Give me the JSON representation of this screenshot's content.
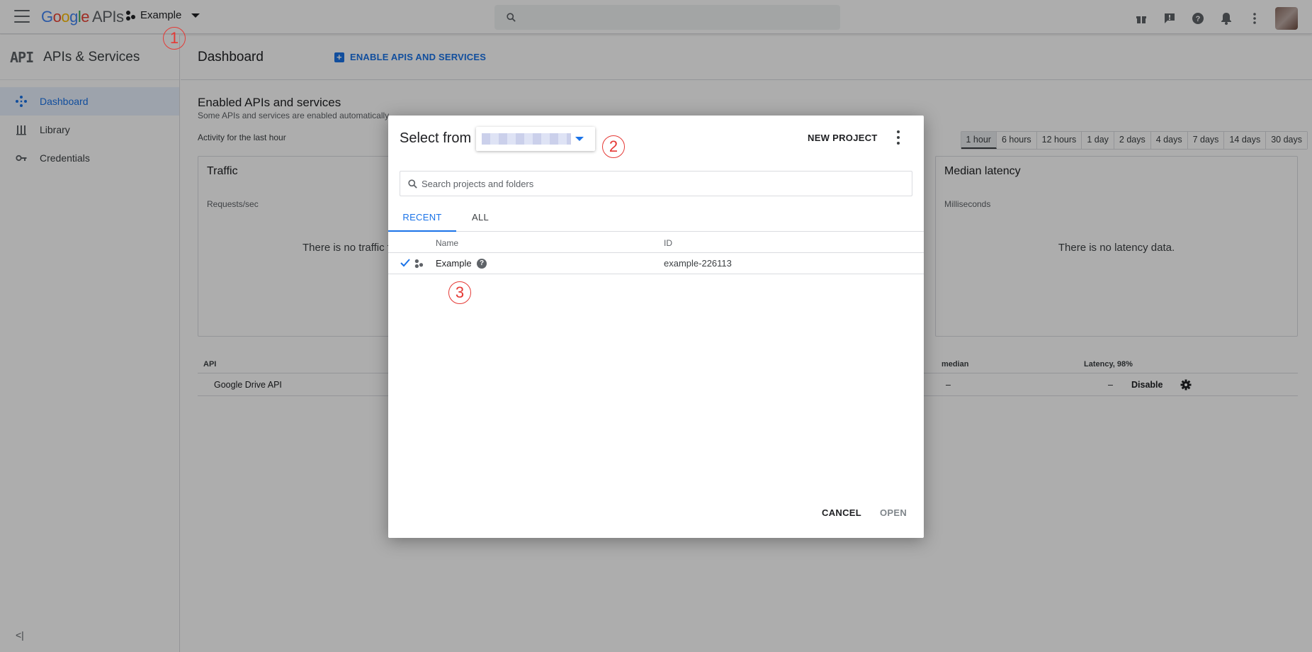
{
  "topbar": {
    "logo_google": [
      "G",
      "o",
      "o",
      "g",
      "l",
      "e"
    ],
    "logo_apis": "APIs",
    "project_name": "Example",
    "search_placeholder": ""
  },
  "sidebar": {
    "logo": "API",
    "title": "APIs & Services",
    "items": [
      {
        "label": "Dashboard",
        "icon": "dashboard-diamond-icon",
        "active": true
      },
      {
        "label": "Library",
        "icon": "library-icon",
        "active": false
      },
      {
        "label": "Credentials",
        "icon": "key-icon",
        "active": false
      }
    ],
    "collapse_label": "<|"
  },
  "main": {
    "title": "Dashboard",
    "enable_button": "ENABLE APIS AND SERVICES",
    "section_title": "Enabled APIs and services",
    "section_sub": "Some APIs and services are enabled automatically",
    "activity_label": "Activity for the last hour",
    "ranges": [
      "1 hour",
      "6 hours",
      "12 hours",
      "1 day",
      "2 days",
      "4 days",
      "7 days",
      "14 days",
      "30 days"
    ],
    "active_range": "1 hour",
    "traffic_card": {
      "title": "Traffic",
      "sub": "Requests/sec",
      "empty": "There is no traffic fo"
    },
    "latency_card": {
      "title": "Median latency",
      "sub": "Milliseconds",
      "empty": "There is no latency data."
    },
    "table": {
      "col_api": "API",
      "col_median": "median",
      "col_latency": "Latency, 98%",
      "rows": [
        {
          "name": "Google Drive API",
          "median": "–",
          "latency": "–",
          "action": "Disable"
        }
      ]
    }
  },
  "dialog": {
    "title": "Select from",
    "new_project": "NEW PROJECT",
    "search_placeholder": "Search projects and folders",
    "tabs": [
      "RECENT",
      "ALL"
    ],
    "active_tab": "RECENT",
    "columns": {
      "name": "Name",
      "id": "ID"
    },
    "projects": [
      {
        "name": "Example",
        "id": "example-226113",
        "selected": true
      }
    ],
    "cancel": "CANCEL",
    "open": "OPEN"
  },
  "annotations": [
    "1",
    "2",
    "3"
  ],
  "colors": {
    "accent": "#1a73e8",
    "annotation": "#e53935",
    "scrim": "rgba(0,0,0,0.32)"
  }
}
